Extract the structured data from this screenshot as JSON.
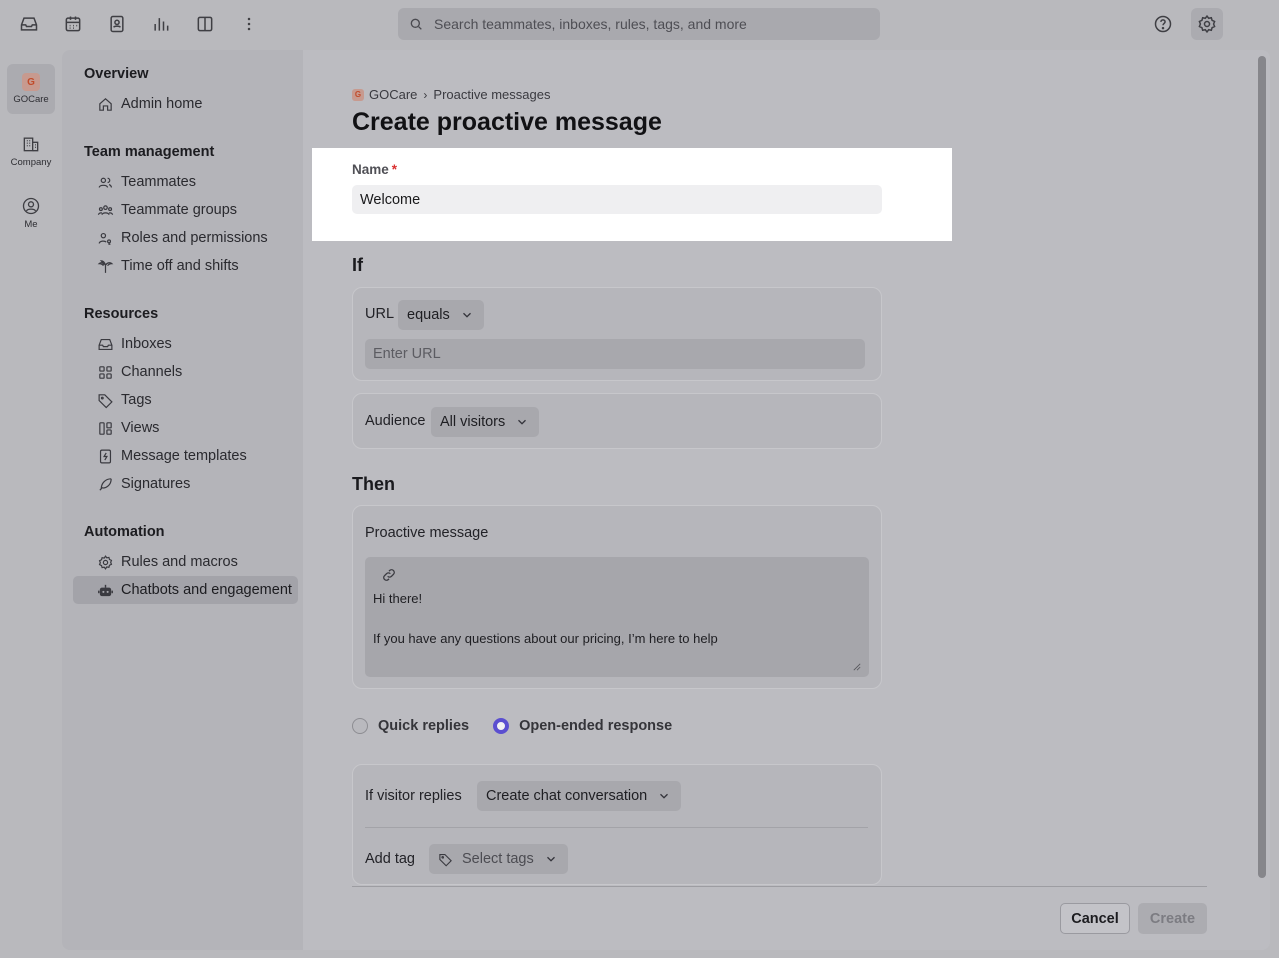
{
  "topbar": {
    "search_placeholder": "Search teammates, inboxes, rules, tags, and more"
  },
  "rail": {
    "org_initial": "G",
    "org_label": "GOCare",
    "company_label": "Company",
    "me_label": "Me"
  },
  "nav": {
    "overview": {
      "title": "Overview",
      "items": [
        "Admin home"
      ]
    },
    "team": {
      "title": "Team management",
      "items": [
        "Teammates",
        "Teammate groups",
        "Roles and permissions",
        "Time off and shifts"
      ]
    },
    "resources": {
      "title": "Resources",
      "items": [
        "Inboxes",
        "Channels",
        "Tags",
        "Views",
        "Message templates",
        "Signatures"
      ]
    },
    "automation": {
      "title": "Automation",
      "items": [
        "Rules and macros",
        "Chatbots and engagement"
      ]
    }
  },
  "breadcrumb": {
    "org_initial": "G",
    "org": "GOCare",
    "section": "Proactive messages"
  },
  "page": {
    "title": "Create proactive message"
  },
  "form": {
    "name_label": "Name",
    "name_required": "*",
    "name_value": "Welcome",
    "if_heading": "If",
    "url_label": "URL",
    "url_operator": "equals",
    "url_placeholder": "Enter URL",
    "audience_label": "Audience",
    "audience_value": "All visitors",
    "then_heading": "Then",
    "message_label": "Proactive message",
    "message_line1": "Hi there!",
    "message_line2": "If you have any questions about our pricing, I’m here to help",
    "response_options": {
      "quick": "Quick replies",
      "open": "Open-ended response",
      "selected": "open"
    },
    "visitor_replies_label": "If visitor replies",
    "visitor_replies_value": "Create chat conversation",
    "add_tag_label": "Add tag",
    "tag_placeholder": "Select tags"
  },
  "footer": {
    "cancel": "Cancel",
    "create": "Create"
  },
  "colors": {
    "accent": "#5b4fd0",
    "required": "#d93030",
    "org_badge": "#c14b2a"
  }
}
